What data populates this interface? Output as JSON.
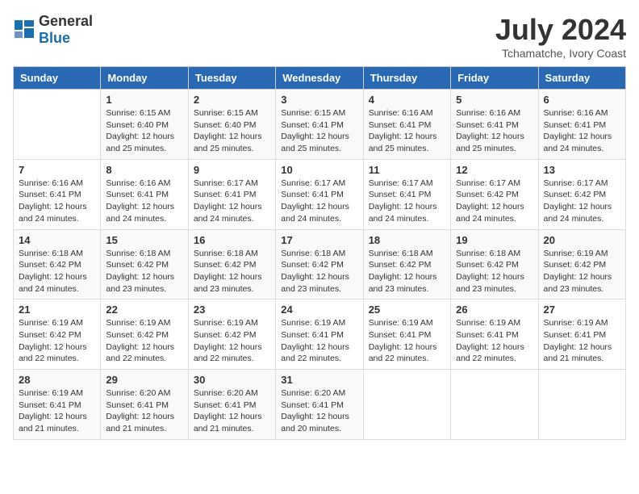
{
  "logo": {
    "general": "General",
    "blue": "Blue"
  },
  "title": "July 2024",
  "location": "Tchamatche, Ivory Coast",
  "days_of_week": [
    "Sunday",
    "Monday",
    "Tuesday",
    "Wednesday",
    "Thursday",
    "Friday",
    "Saturday"
  ],
  "weeks": [
    [
      {
        "day": "",
        "info": ""
      },
      {
        "day": "1",
        "info": "Sunrise: 6:15 AM\nSunset: 6:40 PM\nDaylight: 12 hours\nand 25 minutes."
      },
      {
        "day": "2",
        "info": "Sunrise: 6:15 AM\nSunset: 6:40 PM\nDaylight: 12 hours\nand 25 minutes."
      },
      {
        "day": "3",
        "info": "Sunrise: 6:15 AM\nSunset: 6:41 PM\nDaylight: 12 hours\nand 25 minutes."
      },
      {
        "day": "4",
        "info": "Sunrise: 6:16 AM\nSunset: 6:41 PM\nDaylight: 12 hours\nand 25 minutes."
      },
      {
        "day": "5",
        "info": "Sunrise: 6:16 AM\nSunset: 6:41 PM\nDaylight: 12 hours\nand 25 minutes."
      },
      {
        "day": "6",
        "info": "Sunrise: 6:16 AM\nSunset: 6:41 PM\nDaylight: 12 hours\nand 24 minutes."
      }
    ],
    [
      {
        "day": "7",
        "info": "Sunrise: 6:16 AM\nSunset: 6:41 PM\nDaylight: 12 hours\nand 24 minutes."
      },
      {
        "day": "8",
        "info": "Sunrise: 6:16 AM\nSunset: 6:41 PM\nDaylight: 12 hours\nand 24 minutes."
      },
      {
        "day": "9",
        "info": "Sunrise: 6:17 AM\nSunset: 6:41 PM\nDaylight: 12 hours\nand 24 minutes."
      },
      {
        "day": "10",
        "info": "Sunrise: 6:17 AM\nSunset: 6:41 PM\nDaylight: 12 hours\nand 24 minutes."
      },
      {
        "day": "11",
        "info": "Sunrise: 6:17 AM\nSunset: 6:41 PM\nDaylight: 12 hours\nand 24 minutes."
      },
      {
        "day": "12",
        "info": "Sunrise: 6:17 AM\nSunset: 6:42 PM\nDaylight: 12 hours\nand 24 minutes."
      },
      {
        "day": "13",
        "info": "Sunrise: 6:17 AM\nSunset: 6:42 PM\nDaylight: 12 hours\nand 24 minutes."
      }
    ],
    [
      {
        "day": "14",
        "info": "Sunrise: 6:18 AM\nSunset: 6:42 PM\nDaylight: 12 hours\nand 24 minutes."
      },
      {
        "day": "15",
        "info": "Sunrise: 6:18 AM\nSunset: 6:42 PM\nDaylight: 12 hours\nand 23 minutes."
      },
      {
        "day": "16",
        "info": "Sunrise: 6:18 AM\nSunset: 6:42 PM\nDaylight: 12 hours\nand 23 minutes."
      },
      {
        "day": "17",
        "info": "Sunrise: 6:18 AM\nSunset: 6:42 PM\nDaylight: 12 hours\nand 23 minutes."
      },
      {
        "day": "18",
        "info": "Sunrise: 6:18 AM\nSunset: 6:42 PM\nDaylight: 12 hours\nand 23 minutes."
      },
      {
        "day": "19",
        "info": "Sunrise: 6:18 AM\nSunset: 6:42 PM\nDaylight: 12 hours\nand 23 minutes."
      },
      {
        "day": "20",
        "info": "Sunrise: 6:19 AM\nSunset: 6:42 PM\nDaylight: 12 hours\nand 23 minutes."
      }
    ],
    [
      {
        "day": "21",
        "info": "Sunrise: 6:19 AM\nSunset: 6:42 PM\nDaylight: 12 hours\nand 22 minutes."
      },
      {
        "day": "22",
        "info": "Sunrise: 6:19 AM\nSunset: 6:42 PM\nDaylight: 12 hours\nand 22 minutes."
      },
      {
        "day": "23",
        "info": "Sunrise: 6:19 AM\nSunset: 6:42 PM\nDaylight: 12 hours\nand 22 minutes."
      },
      {
        "day": "24",
        "info": "Sunrise: 6:19 AM\nSunset: 6:41 PM\nDaylight: 12 hours\nand 22 minutes."
      },
      {
        "day": "25",
        "info": "Sunrise: 6:19 AM\nSunset: 6:41 PM\nDaylight: 12 hours\nand 22 minutes."
      },
      {
        "day": "26",
        "info": "Sunrise: 6:19 AM\nSunset: 6:41 PM\nDaylight: 12 hours\nand 22 minutes."
      },
      {
        "day": "27",
        "info": "Sunrise: 6:19 AM\nSunset: 6:41 PM\nDaylight: 12 hours\nand 21 minutes."
      }
    ],
    [
      {
        "day": "28",
        "info": "Sunrise: 6:19 AM\nSunset: 6:41 PM\nDaylight: 12 hours\nand 21 minutes."
      },
      {
        "day": "29",
        "info": "Sunrise: 6:20 AM\nSunset: 6:41 PM\nDaylight: 12 hours\nand 21 minutes."
      },
      {
        "day": "30",
        "info": "Sunrise: 6:20 AM\nSunset: 6:41 PM\nDaylight: 12 hours\nand 21 minutes."
      },
      {
        "day": "31",
        "info": "Sunrise: 6:20 AM\nSunset: 6:41 PM\nDaylight: 12 hours\nand 20 minutes."
      },
      {
        "day": "",
        "info": ""
      },
      {
        "day": "",
        "info": ""
      },
      {
        "day": "",
        "info": ""
      }
    ]
  ]
}
